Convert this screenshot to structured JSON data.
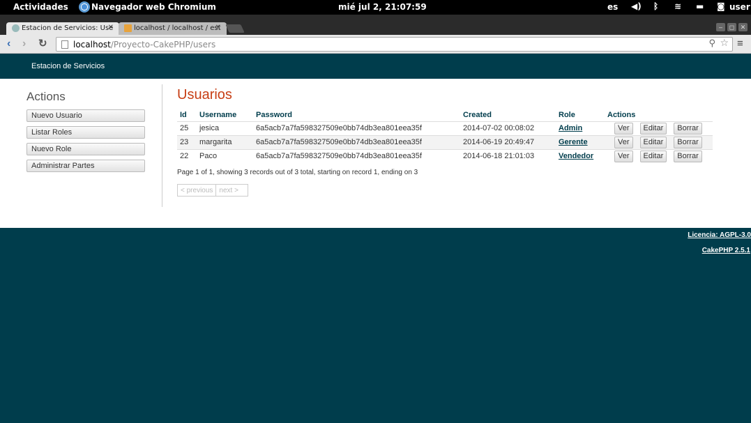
{
  "os_bar": {
    "activities": "Actividades",
    "app_name": "Navegador web Chromium",
    "clock": "mié jul 2, 21:07:59",
    "lang": "es",
    "user": "user"
  },
  "browser": {
    "tabs": [
      {
        "label": "Estacion de Servicios: Use",
        "active": true
      },
      {
        "label": "localhost / localhost / est",
        "active": false
      }
    ],
    "url_host": "localhost",
    "url_path": "/Proyecto-CakePHP/users"
  },
  "site": {
    "brand": "Estacion de Servicios"
  },
  "sidebar": {
    "title": "Actions",
    "items": [
      {
        "label": "Nuevo Usuario"
      },
      {
        "label": "Listar Roles"
      },
      {
        "label": "Nuevo Role"
      },
      {
        "label": "Administrar Partes"
      }
    ]
  },
  "users": {
    "title": "Usuarios",
    "columns": [
      "Id",
      "Username",
      "Password",
      "Created",
      "Role",
      "Actions"
    ],
    "rows": [
      {
        "id": "25",
        "username": "jesica",
        "password": "6a5acb7a7fa598327509e0bb74db3ea801eea35f",
        "created": "2014-07-02 00:08:02",
        "role": "Admin"
      },
      {
        "id": "23",
        "username": "margarita",
        "password": "6a5acb7a7fa598327509e0bb74db3ea801eea35f",
        "created": "2014-06-19 20:49:47",
        "role": "Gerente"
      },
      {
        "id": "22",
        "username": "Paco",
        "password": "6a5acb7a7fa598327509e0bb74db3ea801eea35f",
        "created": "2014-06-18 21:01:03",
        "role": "Vendedor"
      }
    ],
    "actions": {
      "view": "Ver",
      "edit": "Editar",
      "delete": "Borrar"
    },
    "paging_text": "Page 1 of 1, showing 3 records out of 3 total, starting on record 1, ending on 3",
    "prev": "< previous",
    "next": "next >"
  },
  "footer": {
    "license": "Licencia: AGPL-3.0",
    "cakephp": "CakePHP 2.5.1"
  }
}
